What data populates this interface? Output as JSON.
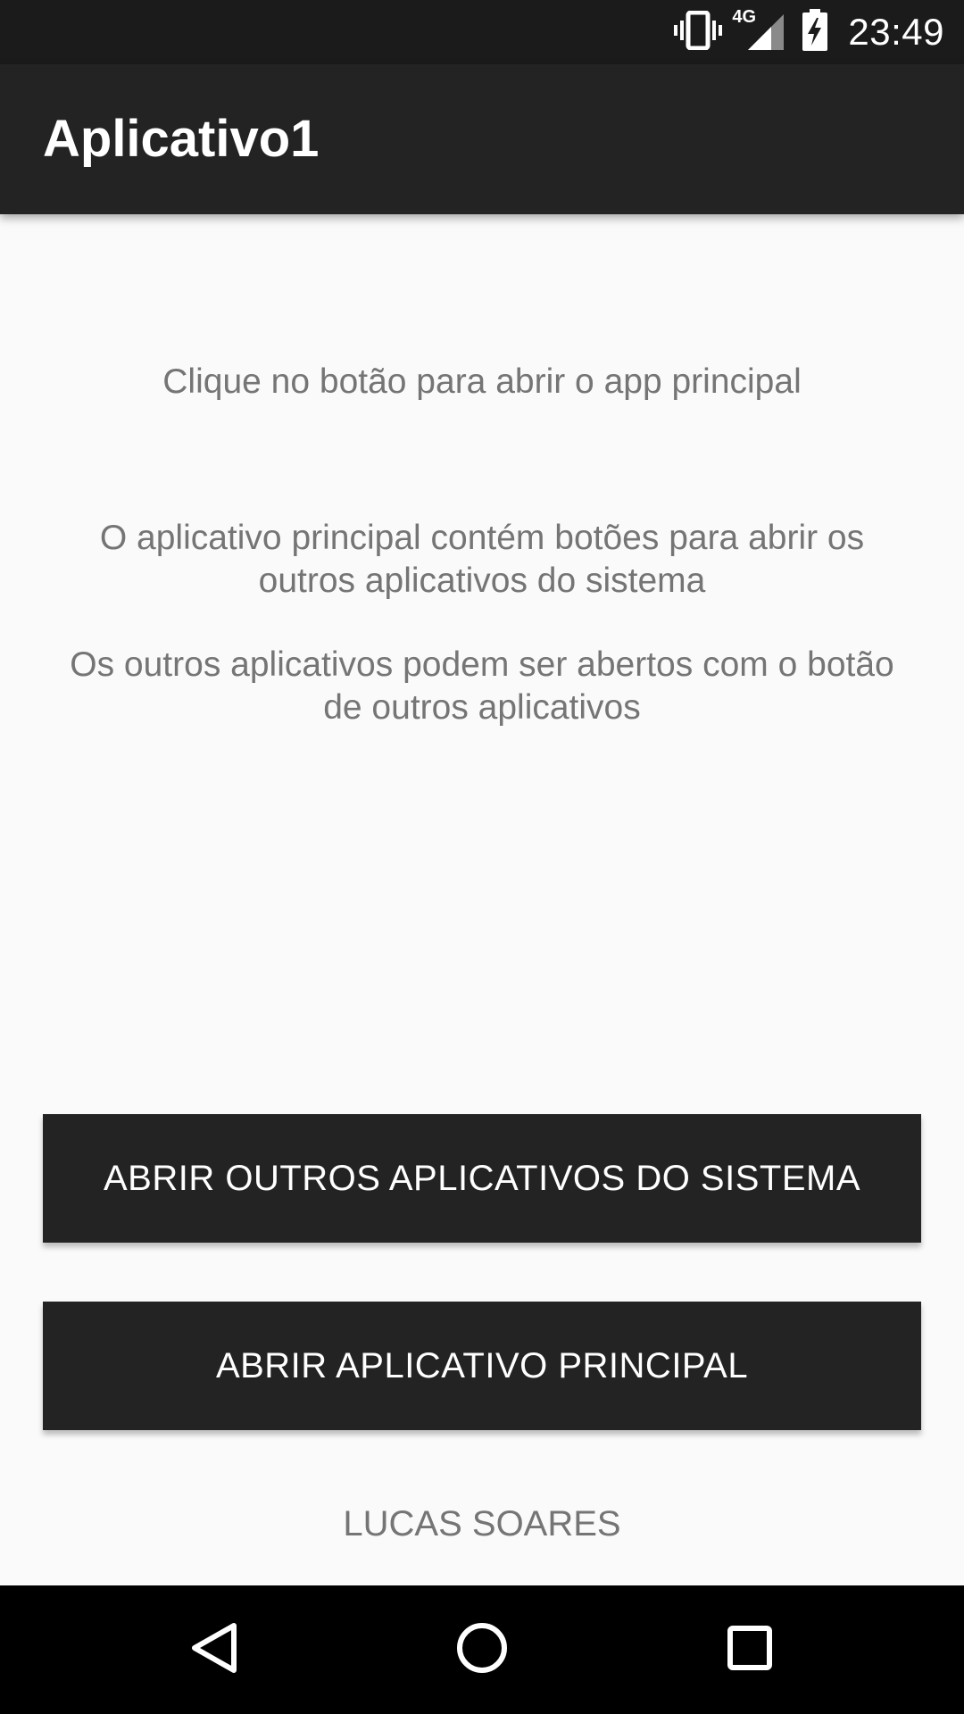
{
  "status_bar": {
    "time": "23:49",
    "network": "4G",
    "icons": [
      "vibrate-icon",
      "signal-icon",
      "battery-charging-icon"
    ]
  },
  "app_bar": {
    "title": "Aplicativo1"
  },
  "content": {
    "instruction": "Clique no botão para abrir o app principal",
    "info_line1": "O aplicativo principal contém botões para abrir os outros aplicativos do sistema",
    "info_line2": "Os outros aplicativos podem ser abertos com o botão de outros aplicativos"
  },
  "buttons": {
    "open_other_apps": "ABRIR OUTROS APLICATIVOS DO SISTEMA",
    "open_main_app": "ABRIR APLICATIVO PRINCIPAL"
  },
  "footer": {
    "author": "LUCAS SOARES"
  },
  "nav_bar": {
    "icons": [
      "back-icon",
      "home-icon",
      "recents-icon"
    ]
  },
  "colors": {
    "status_bar": "#1b1b1b",
    "app_bar": "#232323",
    "button": "#232323",
    "background": "#fafafa",
    "text_secondary": "#757575"
  }
}
